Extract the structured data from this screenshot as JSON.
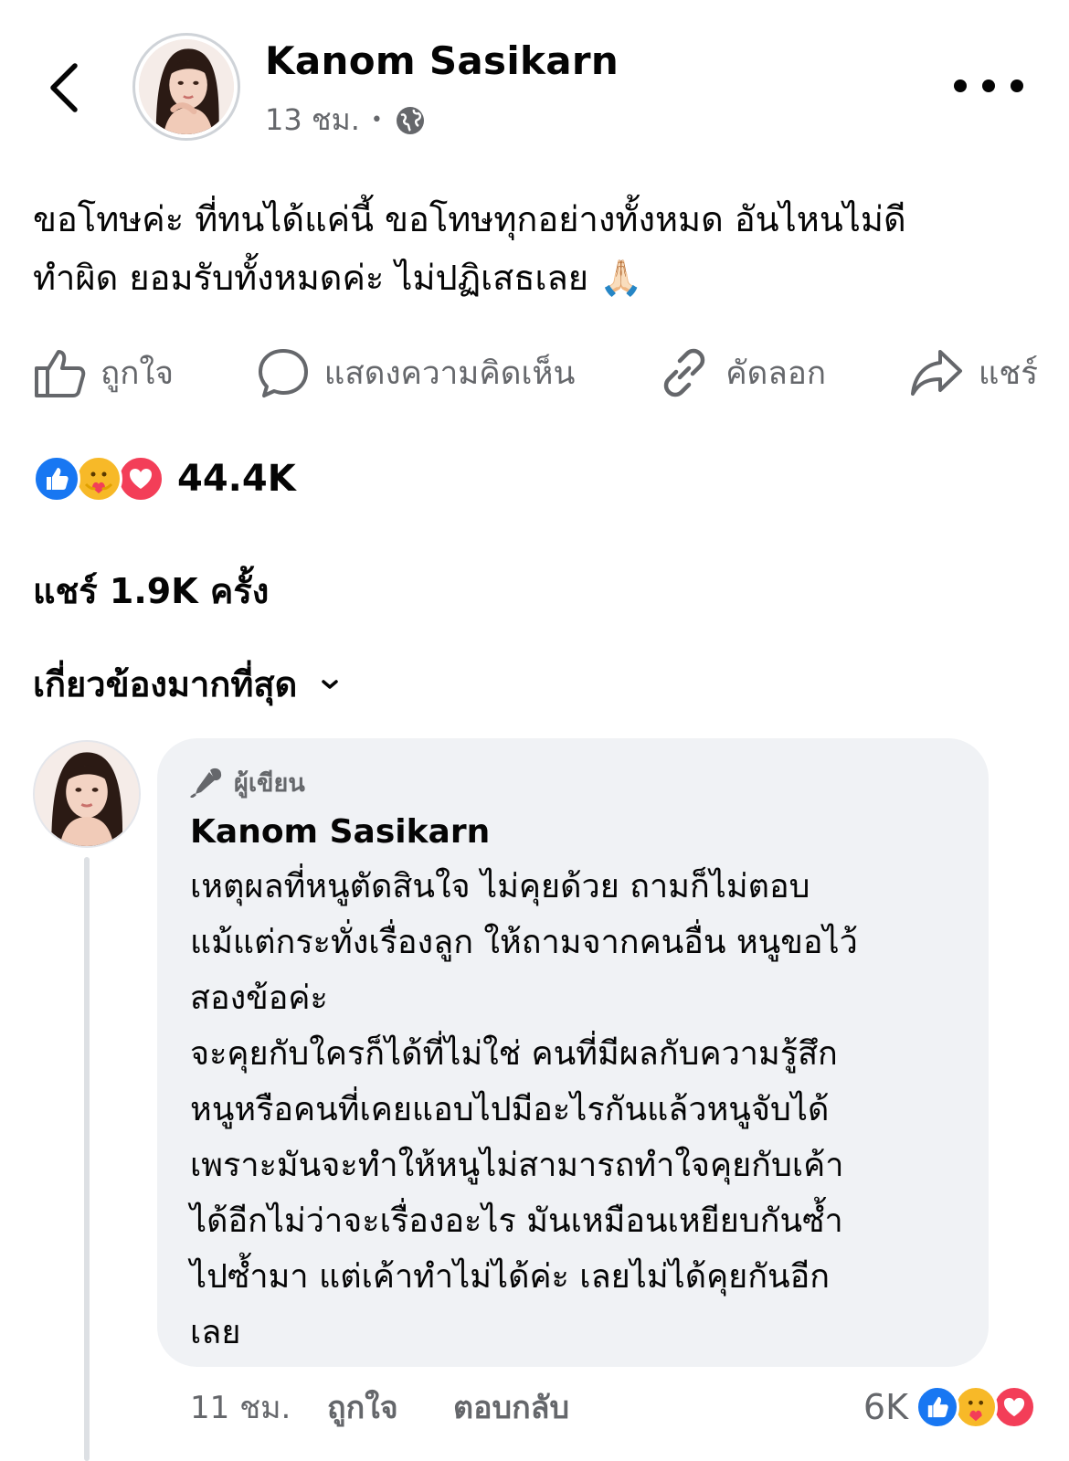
{
  "post": {
    "author": "Kanom Sasikarn",
    "time": "13 ชม.",
    "separator": "•",
    "text_line1": "ขอโทษค่ะ ที่ทนได้แค่นี้ ขอโทษทุกอย่างทั้งหมด อันไหนไม่ดี",
    "text_line2": "ทำผิด ยอมรับทั้งหมดค่ะ ไม่ปฏิเสธเลย 🙏🏻"
  },
  "actions": {
    "like": "ถูกใจ",
    "comment": "แสดงความคิดเห็น",
    "copy": "คัดลอก",
    "share": "แชร์"
  },
  "stats": {
    "reactions": "44.4K",
    "shares": "แชร์ 1.9K ครั้ง"
  },
  "sort": {
    "label": "เกี่ยวข้องมากที่สุด"
  },
  "comment": {
    "badge": "ผู้เขียน",
    "author": "Kanom Sasikarn",
    "text": "เหตุผลที่หนูตัดสินใจ ไม่คุยด้วย ถามก็ไม่ตอบ\nแม้แต่กระทั่งเรื่องลูก ให้ถามจากคนอื่น หนูขอไว้\nสองข้อค่ะ\nจะคุยกับใครก็ได้ที่ไม่ใช่ คนที่มีผลกับความรู้สึก\nหนูหรือคนที่เคยแอบไปมีอะไรกันแล้วหนูจับได้\nเพราะมันจะทำให้หนูไม่สามารถทำใจคุยกับเค้า\nได้อีกไม่ว่าจะเรื่องอะไร มันเหมือนเหยียบกันซ้ำ\nไปซ้ำมา แต่เค้าทำไม่ได้ค่ะ เลยไม่ได้คุยกันอีก\nเลย",
    "time": "11 ชม.",
    "like": "ถูกใจ",
    "reply": "ตอบกลับ",
    "reaction_count": "6K"
  },
  "colors": {
    "like_blue": "#1877f2",
    "care_yellow": "#f7b928",
    "love_red": "#f33e58",
    "secondary_text": "#65676b",
    "bubble_bg": "#f0f2f5"
  },
  "icons": [
    "back-chevron-icon",
    "globe-icon",
    "more-icon",
    "thumbs-up-icon",
    "comment-icon",
    "link-icon",
    "share-arrow-icon",
    "like-reaction-icon",
    "care-reaction-icon",
    "love-reaction-icon",
    "chevron-down-icon",
    "author-badge-icon"
  ]
}
